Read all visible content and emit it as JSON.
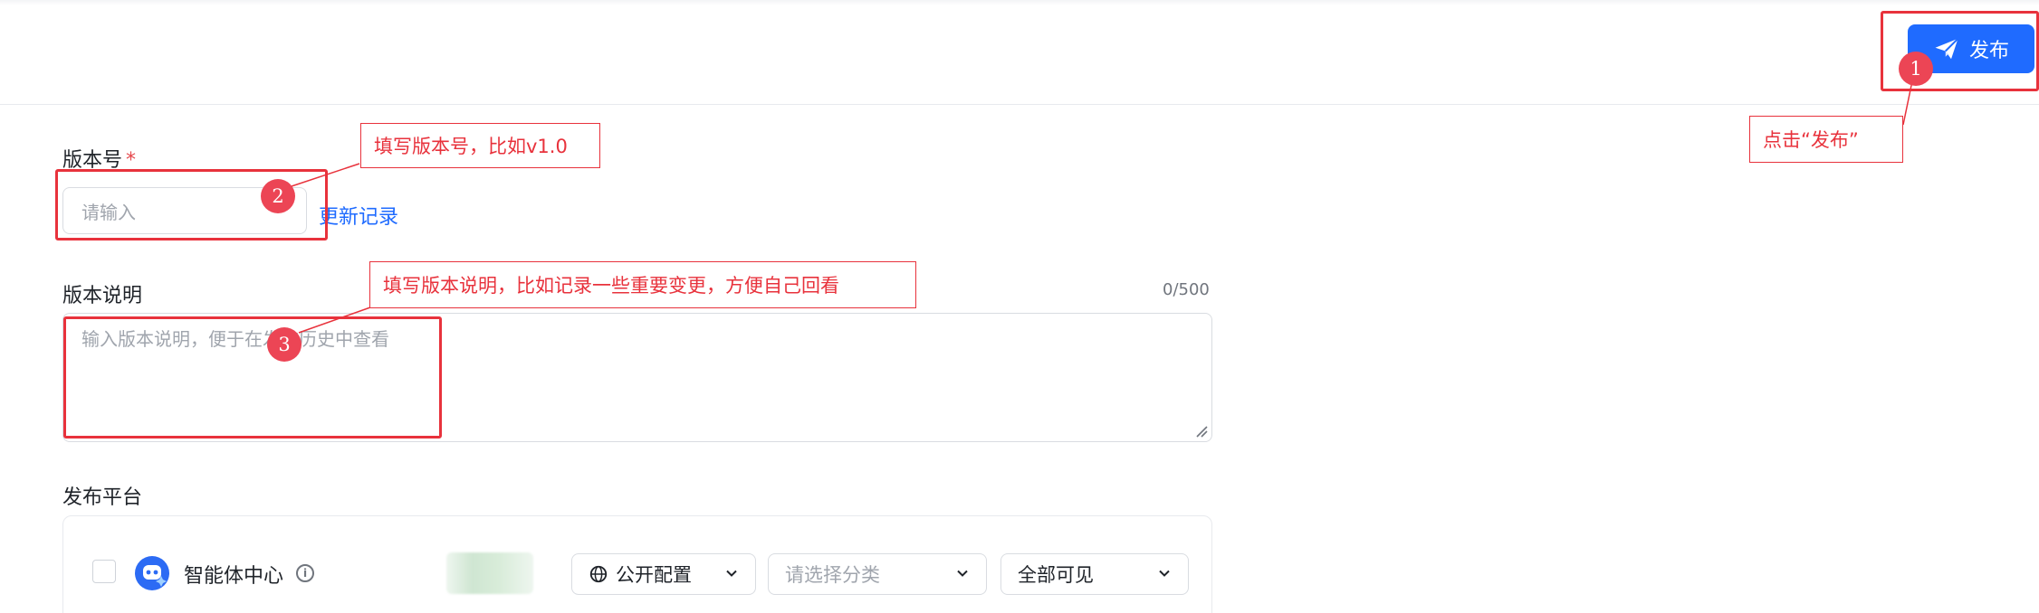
{
  "header": {
    "publish_label": "发布",
    "publish_icon": "send-icon"
  },
  "form": {
    "version": {
      "label": "版本号",
      "required_mark": "*",
      "placeholder": "请输入",
      "history_link": "更新记录"
    },
    "description": {
      "label": "版本说明",
      "counter": "0/500",
      "placeholder": "输入版本说明，便于在发布历史中查看"
    },
    "platform": {
      "label": "发布平台",
      "rows": [
        {
          "name": "智能体中心",
          "info_icon": "info-icon",
          "config_select": "公开配置",
          "category_placeholder": "请选择分类",
          "visibility_select": "全部可见"
        }
      ]
    }
  },
  "annotations": {
    "step1": {
      "badge": "1",
      "text": "点击“发布”"
    },
    "step2": {
      "badge": "2",
      "text": "填写版本号，比如v1.0"
    },
    "step3": {
      "badge": "3",
      "text": "填写版本说明，比如记录一些重要变更，方便自己回看"
    },
    "color": "#e8323c"
  },
  "colors": {
    "primary": "#1f6bff",
    "required": "#e5484d",
    "annotation_badge": "#ec4555"
  }
}
